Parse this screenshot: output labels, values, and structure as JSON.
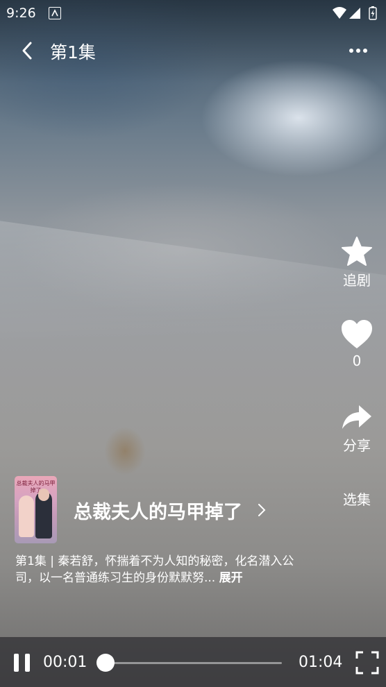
{
  "status_bar": {
    "time": "9:26"
  },
  "header": {
    "title": "第1集"
  },
  "actions": {
    "follow_label": "追剧",
    "like_count": "0",
    "share_label": "分享",
    "episodes_label": "选集"
  },
  "drama": {
    "poster_text": "总裁夫人的马甲掉了",
    "name": "总裁夫人的马甲掉了",
    "description": "第1集 | 秦若舒，怀揣着不为人知的秘密，化名潜入公司，以一名普通练习生的身份默默努...",
    "expand_label": "展开"
  },
  "player": {
    "current_time": "00:01",
    "duration": "01:04",
    "progress": 0.0
  },
  "colors": {
    "text": "#ffffff",
    "control_bar": "#2d2d30"
  }
}
